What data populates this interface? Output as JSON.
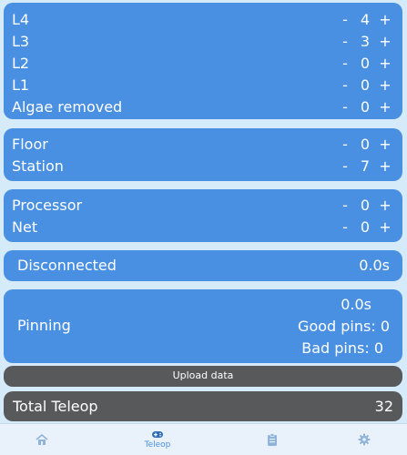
{
  "groups": [
    {
      "rows": [
        {
          "label": "L4",
          "minus": "-",
          "value": "4",
          "plus": "+"
        },
        {
          "label": "L3",
          "minus": "-",
          "value": "3",
          "plus": "+"
        },
        {
          "label": "L2",
          "minus": "-",
          "value": "0",
          "plus": "+"
        },
        {
          "label": "L1",
          "minus": "-",
          "value": "0",
          "plus": "+"
        },
        {
          "label": "Algae removed",
          "minus": "-",
          "value": "0",
          "plus": "+"
        }
      ]
    },
    {
      "rows": [
        {
          "label": "Floor",
          "minus": "-",
          "value": "0",
          "plus": "+"
        },
        {
          "label": "Station",
          "minus": "-",
          "value": "7",
          "plus": "+"
        }
      ]
    },
    {
      "rows": [
        {
          "label": "Processor",
          "minus": "-",
          "value": "0",
          "plus": "+"
        },
        {
          "label": "Net",
          "minus": "-",
          "value": "0",
          "plus": "+"
        }
      ]
    }
  ],
  "disconnected": {
    "label": "Disconnected",
    "time": "0.0s"
  },
  "pinning": {
    "label": "Pinning",
    "time": "0.0s",
    "good": "Good pins: 0",
    "bad": "Bad pins: 0"
  },
  "upload": {
    "label": "Upload data"
  },
  "total": {
    "label": "Total Teleop",
    "value": "32"
  },
  "nav": {
    "items": [
      {
        "icon": "home-icon",
        "label": ""
      },
      {
        "icon": "gamepad-icon",
        "label": "Teleop",
        "active": true
      },
      {
        "icon": "clipboard-icon",
        "label": ""
      },
      {
        "icon": "gear-icon",
        "label": ""
      }
    ]
  },
  "colors": {
    "card": "#4a90e2",
    "background": "#d6ebfa",
    "dark": "#58595b"
  }
}
